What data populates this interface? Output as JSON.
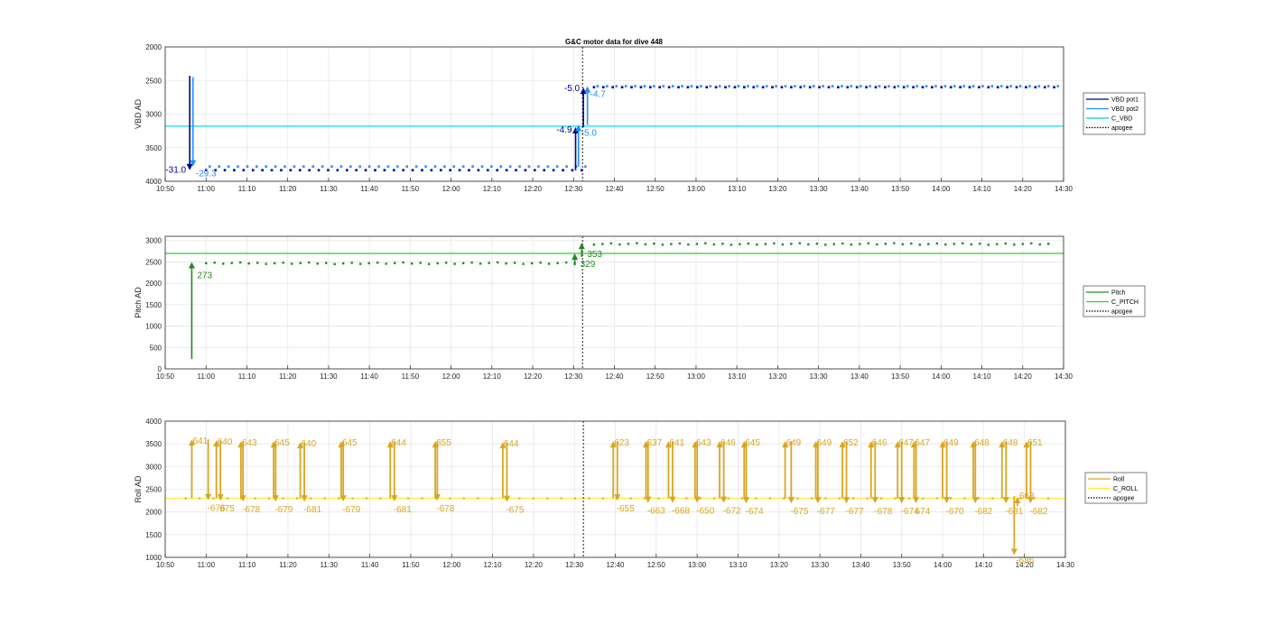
{
  "figure": {
    "title": "G&C motor data for dive 448"
  },
  "xaxis": {
    "ticks": [
      "10:50",
      "11:00",
      "11:10",
      "11:20",
      "11:30",
      "11:40",
      "11:50",
      "12:00",
      "12:10",
      "12:20",
      "12:30",
      "12:40",
      "12:50",
      "13:00",
      "13:10",
      "13:20",
      "13:30",
      "13:40",
      "13:50",
      "14:00",
      "14:10",
      "14:20",
      "14:30"
    ],
    "range_minutes": [
      650,
      870
    ],
    "apogee_minute": 752.2
  },
  "chart_data": [
    {
      "type": "scatter",
      "id": "vbd",
      "ylabel": "VBD AD",
      "ylim": [
        2000,
        4000
      ],
      "y_reversed": true,
      "yticks": [
        "2000",
        "2500",
        "3000",
        "3500",
        "4000"
      ],
      "grid": true,
      "legend_position": "right",
      "legend": [
        {
          "label": "VBD pot1",
          "color": "#00008B",
          "style": "solid"
        },
        {
          "label": "VBD pot2",
          "color": "#1E90FF",
          "style": "solid"
        },
        {
          "label": "C_VBD",
          "color": "#00CED1",
          "style": "solid"
        },
        {
          "label": "apogee",
          "color": "#000000",
          "style": "dotted"
        }
      ],
      "reference_line": {
        "name": "C_VBD",
        "y": 3180,
        "color": "#00E5EE"
      },
      "phases": [
        {
          "from": 660,
          "to": 752,
          "pot1": 3835,
          "pot2": 3780
        },
        {
          "from": 755,
          "to": 868,
          "pot1": 2600,
          "pot2": 2585
        }
      ],
      "arrows": [
        {
          "x": 656.0,
          "y_start": 2430,
          "y_end": 3835,
          "color": "#00008B",
          "label": "-31.0",
          "label_side": "left"
        },
        {
          "x": 656.8,
          "y_start": 2450,
          "y_end": 3780,
          "color": "#1E90FF",
          "label": "-29.3",
          "label_side": "right"
        },
        {
          "x": 750.5,
          "y_start": 3835,
          "y_end": 3195,
          "color": "#00008B",
          "label": "-4.9",
          "label_side": "left"
        },
        {
          "x": 751.2,
          "y_start": 3780,
          "y_end": 3160,
          "color": "#1E90FF",
          "label": "-5.0",
          "label_side": "right"
        },
        {
          "x": 752.4,
          "y_start": 3195,
          "y_end": 2605,
          "color": "#00008B",
          "label": "-5.0",
          "label_side": "left"
        },
        {
          "x": 753.4,
          "y_start": 3160,
          "y_end": 2585,
          "color": "#1E90FF",
          "label": "-4.7",
          "label_side": "right"
        }
      ]
    },
    {
      "type": "scatter",
      "id": "pitch",
      "ylabel": "Pitch AD",
      "ylim": [
        0,
        3100
      ],
      "yticks": [
        "0",
        "500",
        "1000",
        "1500",
        "2000",
        "2500",
        "3000"
      ],
      "grid": true,
      "legend_position": "right",
      "legend": [
        {
          "label": "Pitch",
          "color": "#228B22",
          "style": "solid"
        },
        {
          "label": "C_PITCH",
          "color": "#32CD32",
          "style": "solid"
        },
        {
          "label": "apogee",
          "color": "#000000",
          "style": "dotted"
        }
      ],
      "reference_line": {
        "name": "C_PITCH",
        "y": 2700,
        "color": "#32CD32"
      },
      "phases": [
        {
          "from": 660,
          "to": 752,
          "value": 2470
        },
        {
          "from": 755,
          "to": 868,
          "value": 2920
        }
      ],
      "arrows": [
        {
          "x": 656.5,
          "y_start": 230,
          "y_end": 2500,
          "color": "#228B22",
          "label": "273",
          "label_side": "right"
        },
        {
          "x": 750.3,
          "y_start": 2420,
          "y_end": 2700,
          "color": "#228B22",
          "label": "329",
          "label_side": "right"
        },
        {
          "x": 752.0,
          "y_start": 2620,
          "y_end": 2950,
          "color": "#228B22",
          "label": "353",
          "label_side": "right"
        }
      ]
    },
    {
      "type": "scatter",
      "id": "roll",
      "ylabel": "Roll AD",
      "ylim": [
        1000,
        4000
      ],
      "yticks": [
        "1000",
        "1500",
        "2000",
        "2500",
        "3000",
        "3500",
        "4000"
      ],
      "grid": true,
      "legend_position": "right",
      "legend": [
        {
          "label": "Roll",
          "color": "#DAA520",
          "style": "solid"
        },
        {
          "label": "C_ROLL",
          "color": "#FFEB3B",
          "style": "solid"
        },
        {
          "label": "apogee",
          "color": "#000000",
          "style": "dotted"
        }
      ],
      "reference_line": {
        "name": "C_ROLL",
        "y": 2300,
        "color": "#FFE94D"
      },
      "baseline_value": 2300,
      "pulses": [
        {
          "x_up": 656.5,
          "top": 3600,
          "label_top": "641",
          "x_down": 660.5,
          "bottom": 2260,
          "label_bottom": "-676"
        },
        {
          "x_up": 662.5,
          "top": 3580,
          "label_top": "640",
          "x_down": 663.5,
          "bottom": 2250,
          "label_bottom": "675"
        },
        {
          "x_up": 668.5,
          "top": 3560,
          "label_top": "643",
          "x_down": 669.0,
          "bottom": 2230,
          "label_bottom": "-678"
        },
        {
          "x_up": 676.5,
          "top": 3560,
          "label_top": "645",
          "x_down": 677.0,
          "bottom": 2230,
          "label_bottom": "-679"
        },
        {
          "x_up": 683.0,
          "top": 3540,
          "label_top": "640",
          "x_down": 684.0,
          "bottom": 2230,
          "label_bottom": "-681"
        },
        {
          "x_up": 693.0,
          "top": 3560,
          "label_top": "645",
          "x_down": 693.5,
          "bottom": 2230,
          "label_bottom": "-679"
        },
        {
          "x_up": 705.0,
          "top": 3560,
          "label_top": "644",
          "x_down": 706.0,
          "bottom": 2230,
          "label_bottom": "-681"
        },
        {
          "x_up": 716.0,
          "top": 3560,
          "label_top": "655",
          "x_down": 716.5,
          "bottom": 2250,
          "label_bottom": "-678"
        },
        {
          "x_up": 732.5,
          "top": 3540,
          "label_top": "644",
          "x_down": 733.5,
          "bottom": 2220,
          "label_bottom": "-675"
        },
        {
          "x_up": 759.5,
          "top": 3560,
          "label_top": "623",
          "x_down": 760.5,
          "bottom": 2250,
          "label_bottom": "-655"
        },
        {
          "x_up": 767.5,
          "top": 3560,
          "label_top": "637",
          "x_down": 768.0,
          "bottom": 2200,
          "label_bottom": "-663"
        },
        {
          "x_up": 773.0,
          "top": 3560,
          "label_top": "641",
          "x_down": 774.0,
          "bottom": 2200,
          "label_bottom": "-668"
        },
        {
          "x_up": 779.5,
          "top": 3560,
          "label_top": "643",
          "x_down": 780.0,
          "bottom": 2200,
          "label_bottom": "-650"
        },
        {
          "x_up": 785.5,
          "top": 3560,
          "label_top": "646",
          "x_down": 786.5,
          "bottom": 2200,
          "label_bottom": "-672"
        },
        {
          "x_up": 791.5,
          "top": 3560,
          "label_top": "645",
          "x_down": 792.0,
          "bottom": 2190,
          "label_bottom": "-674"
        },
        {
          "x_up": 801.5,
          "top": 3560,
          "label_top": "649",
          "x_down": 803.0,
          "bottom": 2190,
          "label_bottom": "-675"
        },
        {
          "x_up": 809.0,
          "top": 3560,
          "label_top": "649",
          "x_down": 809.5,
          "bottom": 2190,
          "label_bottom": "-677"
        },
        {
          "x_up": 815.5,
          "top": 3560,
          "label_top": "652",
          "x_down": 816.5,
          "bottom": 2190,
          "label_bottom": "-677"
        },
        {
          "x_up": 822.5,
          "top": 3560,
          "label_top": "646",
          "x_down": 823.5,
          "bottom": 2190,
          "label_bottom": "-678"
        },
        {
          "x_up": 829.0,
          "top": 3560,
          "label_top": "647",
          "x_down": 830.0,
          "bottom": 2190,
          "label_bottom": "-674"
        },
        {
          "x_up": 833.0,
          "top": 3560,
          "label_top": "647",
          "x_down": 833.5,
          "bottom": 2190,
          "label_bottom": "674"
        },
        {
          "x_up": 840.0,
          "top": 3560,
          "label_top": "649",
          "x_down": 841.0,
          "bottom": 2190,
          "label_bottom": "-670"
        },
        {
          "x_up": 847.5,
          "top": 3560,
          "label_top": "648",
          "x_down": 848.0,
          "bottom": 2190,
          "label_bottom": "-682"
        },
        {
          "x_up": 854.5,
          "top": 3560,
          "label_top": "648",
          "x_down": 855.5,
          "bottom": 2190,
          "label_bottom": "-681"
        },
        {
          "x_up": 860.5,
          "top": 3560,
          "label_top": "651",
          "x_down": 861.5,
          "bottom": 2190,
          "label_bottom": "-682"
        }
      ],
      "extra_arrows": [
        {
          "x": 857.5,
          "y_start": 2350,
          "y_end": 1050,
          "label": "-686",
          "label_side": "right"
        },
        {
          "x": 858.3,
          "y_start": 2130,
          "y_end": 2330,
          "label": "663",
          "label_side": "right"
        }
      ]
    }
  ]
}
